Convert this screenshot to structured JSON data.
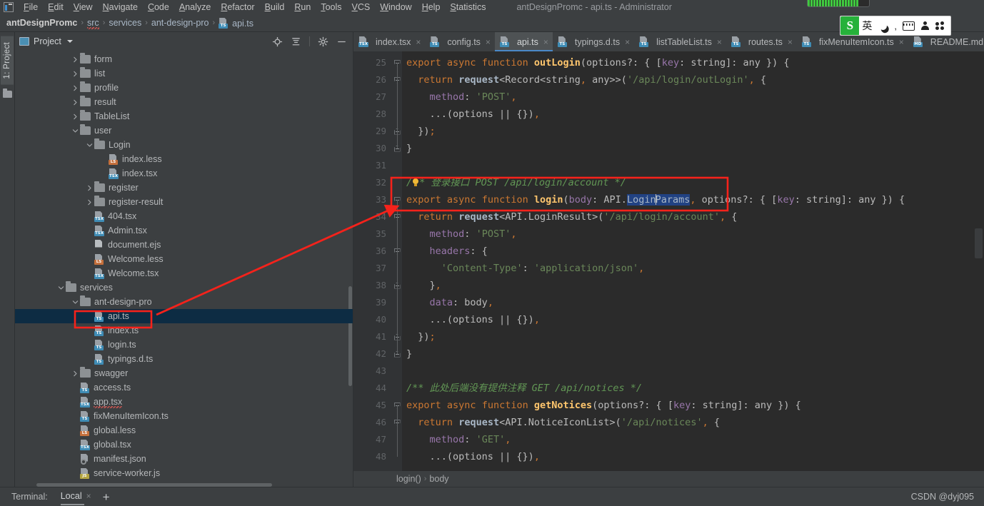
{
  "window": {
    "title": "antDesignPromc - api.ts - Administrator",
    "logo_icon": "intellij-idea-logo"
  },
  "menubar": {
    "items": [
      {
        "label": "File",
        "mnemonic": "F"
      },
      {
        "label": "Edit",
        "mnemonic": "E"
      },
      {
        "label": "View",
        "mnemonic": "V"
      },
      {
        "label": "Navigate",
        "mnemonic": "N"
      },
      {
        "label": "Code",
        "mnemonic": "C"
      },
      {
        "label": "Analyze",
        "mnemonic": "A"
      },
      {
        "label": "Refactor",
        "mnemonic": "R"
      },
      {
        "label": "Build",
        "mnemonic": "B"
      },
      {
        "label": "Run",
        "mnemonic": "R"
      },
      {
        "label": "Tools",
        "mnemonic": "T"
      },
      {
        "label": "VCS",
        "mnemonic": "V"
      },
      {
        "label": "Window",
        "mnemonic": "W"
      },
      {
        "label": "Help",
        "mnemonic": "H"
      },
      {
        "label": "Statistics",
        "mnemonic": "S"
      }
    ]
  },
  "breadcrumb": {
    "segments": [
      "antDesignPromc",
      "src",
      "services",
      "ant-design-pro",
      "api.ts"
    ],
    "separator": "›"
  },
  "ime": {
    "logo": "S",
    "mode": "英",
    "icons": [
      "moon-icon",
      "comma-icon",
      "keyboard-icon",
      "person-icon",
      "clover-icon"
    ]
  },
  "project_panel": {
    "title": "Project",
    "tool_strip_label": "1: Project",
    "toolbar_icons": [
      "locate-icon",
      "collapse-all-icon",
      "gear-icon",
      "minimize-icon"
    ],
    "tree": [
      {
        "label": "form",
        "indent": 3,
        "type": "folder",
        "state": "collapsed"
      },
      {
        "label": "list",
        "indent": 3,
        "type": "folder",
        "state": "collapsed"
      },
      {
        "label": "profile",
        "indent": 3,
        "type": "folder",
        "state": "collapsed"
      },
      {
        "label": "result",
        "indent": 3,
        "type": "folder",
        "state": "collapsed"
      },
      {
        "label": "TableList",
        "indent": 3,
        "type": "folder",
        "state": "collapsed"
      },
      {
        "label": "user",
        "indent": 3,
        "type": "folder",
        "state": "expanded"
      },
      {
        "label": "Login",
        "indent": 4,
        "type": "folder",
        "state": "expanded"
      },
      {
        "label": "index.less",
        "indent": 5,
        "type": "file",
        "badge": "LS",
        "badge_class": "less"
      },
      {
        "label": "index.tsx",
        "indent": 5,
        "type": "file",
        "badge": "TSX",
        "badge_class": "tsx"
      },
      {
        "label": "register",
        "indent": 4,
        "type": "folder",
        "state": "collapsed"
      },
      {
        "label": "register-result",
        "indent": 4,
        "type": "folder",
        "state": "collapsed"
      },
      {
        "label": "404.tsx",
        "indent": 4,
        "type": "file",
        "badge": "TSX",
        "badge_class": "tsx"
      },
      {
        "label": "Admin.tsx",
        "indent": 4,
        "type": "file",
        "badge": "TSX",
        "badge_class": "tsx"
      },
      {
        "label": "document.ejs",
        "indent": 4,
        "type": "file",
        "badge": "",
        "badge_class": "plain"
      },
      {
        "label": "Welcome.less",
        "indent": 4,
        "type": "file",
        "badge": "LS",
        "badge_class": "less"
      },
      {
        "label": "Welcome.tsx",
        "indent": 4,
        "type": "file",
        "badge": "TSX",
        "badge_class": "tsx"
      },
      {
        "label": "services",
        "indent": 2,
        "type": "folder",
        "state": "expanded"
      },
      {
        "label": "ant-design-pro",
        "indent": 3,
        "type": "folder",
        "state": "expanded"
      },
      {
        "label": "api.ts",
        "indent": 4,
        "type": "file",
        "badge": "TS",
        "badge_class": "ts",
        "selected": true,
        "highlighted": true
      },
      {
        "label": "index.ts",
        "indent": 4,
        "type": "file",
        "badge": "TS",
        "badge_class": "ts"
      },
      {
        "label": "login.ts",
        "indent": 4,
        "type": "file",
        "badge": "TS",
        "badge_class": "ts"
      },
      {
        "label": "typings.d.ts",
        "indent": 4,
        "type": "file",
        "badge": "TS",
        "badge_class": "ts"
      },
      {
        "label": "swagger",
        "indent": 3,
        "type": "folder",
        "state": "collapsed"
      },
      {
        "label": "access.ts",
        "indent": 3,
        "type": "file",
        "badge": "TS",
        "badge_class": "ts"
      },
      {
        "label": "app.tsx",
        "indent": 3,
        "type": "file",
        "badge": "TSX",
        "badge_class": "tsx",
        "squiggle": true
      },
      {
        "label": "fixMenuItemIcon.ts",
        "indent": 3,
        "type": "file",
        "badge": "TS",
        "badge_class": "ts"
      },
      {
        "label": "global.less",
        "indent": 3,
        "type": "file",
        "badge": "LS",
        "badge_class": "less"
      },
      {
        "label": "global.tsx",
        "indent": 3,
        "type": "file",
        "badge": "TSX",
        "badge_class": "tsx"
      },
      {
        "label": "manifest.json",
        "indent": 3,
        "type": "file",
        "badge": "",
        "badge_class": "json"
      },
      {
        "label": "service-worker.js",
        "indent": 3,
        "type": "file",
        "badge": "JS",
        "badge_class": "js"
      }
    ]
  },
  "editor": {
    "tabs": [
      {
        "label": "index.tsx",
        "badge": "TSX",
        "badge_class": "tsx",
        "active": false
      },
      {
        "label": "config.ts",
        "badge": "TS",
        "badge_class": "ts",
        "active": false
      },
      {
        "label": "api.ts",
        "badge": "TS",
        "badge_class": "ts",
        "active": true
      },
      {
        "label": "typings.d.ts",
        "badge": "TS",
        "badge_class": "ts",
        "active": false
      },
      {
        "label": "listTableList.ts",
        "badge": "TS",
        "badge_class": "ts",
        "active": false
      },
      {
        "label": "routes.ts",
        "badge": "TS",
        "badge_class": "ts",
        "active": false
      },
      {
        "label": "fixMenuItemIcon.ts",
        "badge": "TS",
        "badge_class": "ts",
        "active": false
      },
      {
        "label": "README.md",
        "badge": "MD",
        "badge_class": "ts",
        "active": false
      }
    ],
    "close_glyph": "×",
    "first_line_number": 25,
    "line_numbers": [
      25,
      26,
      27,
      28,
      29,
      30,
      31,
      32,
      33,
      34,
      35,
      36,
      37,
      38,
      39,
      40,
      41,
      42,
      43,
      44,
      45,
      46,
      47,
      48
    ],
    "selected_token": "LoginParams",
    "lines": [
      {
        "n": 25,
        "text": "export async function outLogin(options?: { [key: string]: any }) {"
      },
      {
        "n": 26,
        "text": "  return request<Record<string, any>>('/api/login/outLogin', {"
      },
      {
        "n": 27,
        "text": "    method: 'POST',"
      },
      {
        "n": 28,
        "text": "    ...(options || {}),"
      },
      {
        "n": 29,
        "text": "  });"
      },
      {
        "n": 30,
        "text": "}"
      },
      {
        "n": 31,
        "text": ""
      },
      {
        "n": 32,
        "text": "/** 登录接口 POST /api/login/account */"
      },
      {
        "n": 33,
        "text": "export async function login(body: API.LoginParams, options?: { [key: string]: any }) {"
      },
      {
        "n": 34,
        "text": "  return request<API.LoginResult>('/api/login/account', {"
      },
      {
        "n": 35,
        "text": "    method: 'POST',"
      },
      {
        "n": 36,
        "text": "    headers: {"
      },
      {
        "n": 37,
        "text": "      'Content-Type': 'application/json',"
      },
      {
        "n": 38,
        "text": "    },"
      },
      {
        "n": 39,
        "text": "    data: body,"
      },
      {
        "n": 40,
        "text": "    ...(options || {}),"
      },
      {
        "n": 41,
        "text": "  });"
      },
      {
        "n": 42,
        "text": "}"
      },
      {
        "n": 43,
        "text": ""
      },
      {
        "n": 44,
        "text": "/** 此处后端没有提供注释 GET /api/notices */"
      },
      {
        "n": 45,
        "text": "export async function getNotices(options?: { [key: string]: any }) {"
      },
      {
        "n": 46,
        "text": "  return request<API.NoticeIconList>('/api/notices', {"
      },
      {
        "n": 47,
        "text": "    method: 'GET',"
      },
      {
        "n": 48,
        "text": "    ...(options || {}),"
      }
    ],
    "status_breadcrumb": {
      "parts": [
        "login()",
        "body"
      ],
      "separator": "›"
    }
  },
  "bottom": {
    "terminal_label": "Terminal:",
    "terminal_tab": "Local",
    "close_glyph": "×",
    "add_glyph": "+",
    "watermark": "CSDN @dyj095"
  },
  "annotation": {
    "color": "#f5221b",
    "boxes": [
      "code-line-32-33-highlight-box",
      "tree-api-ts-highlight-box"
    ],
    "arrow": "arrow-from-tree-api-ts-to-code-login"
  }
}
